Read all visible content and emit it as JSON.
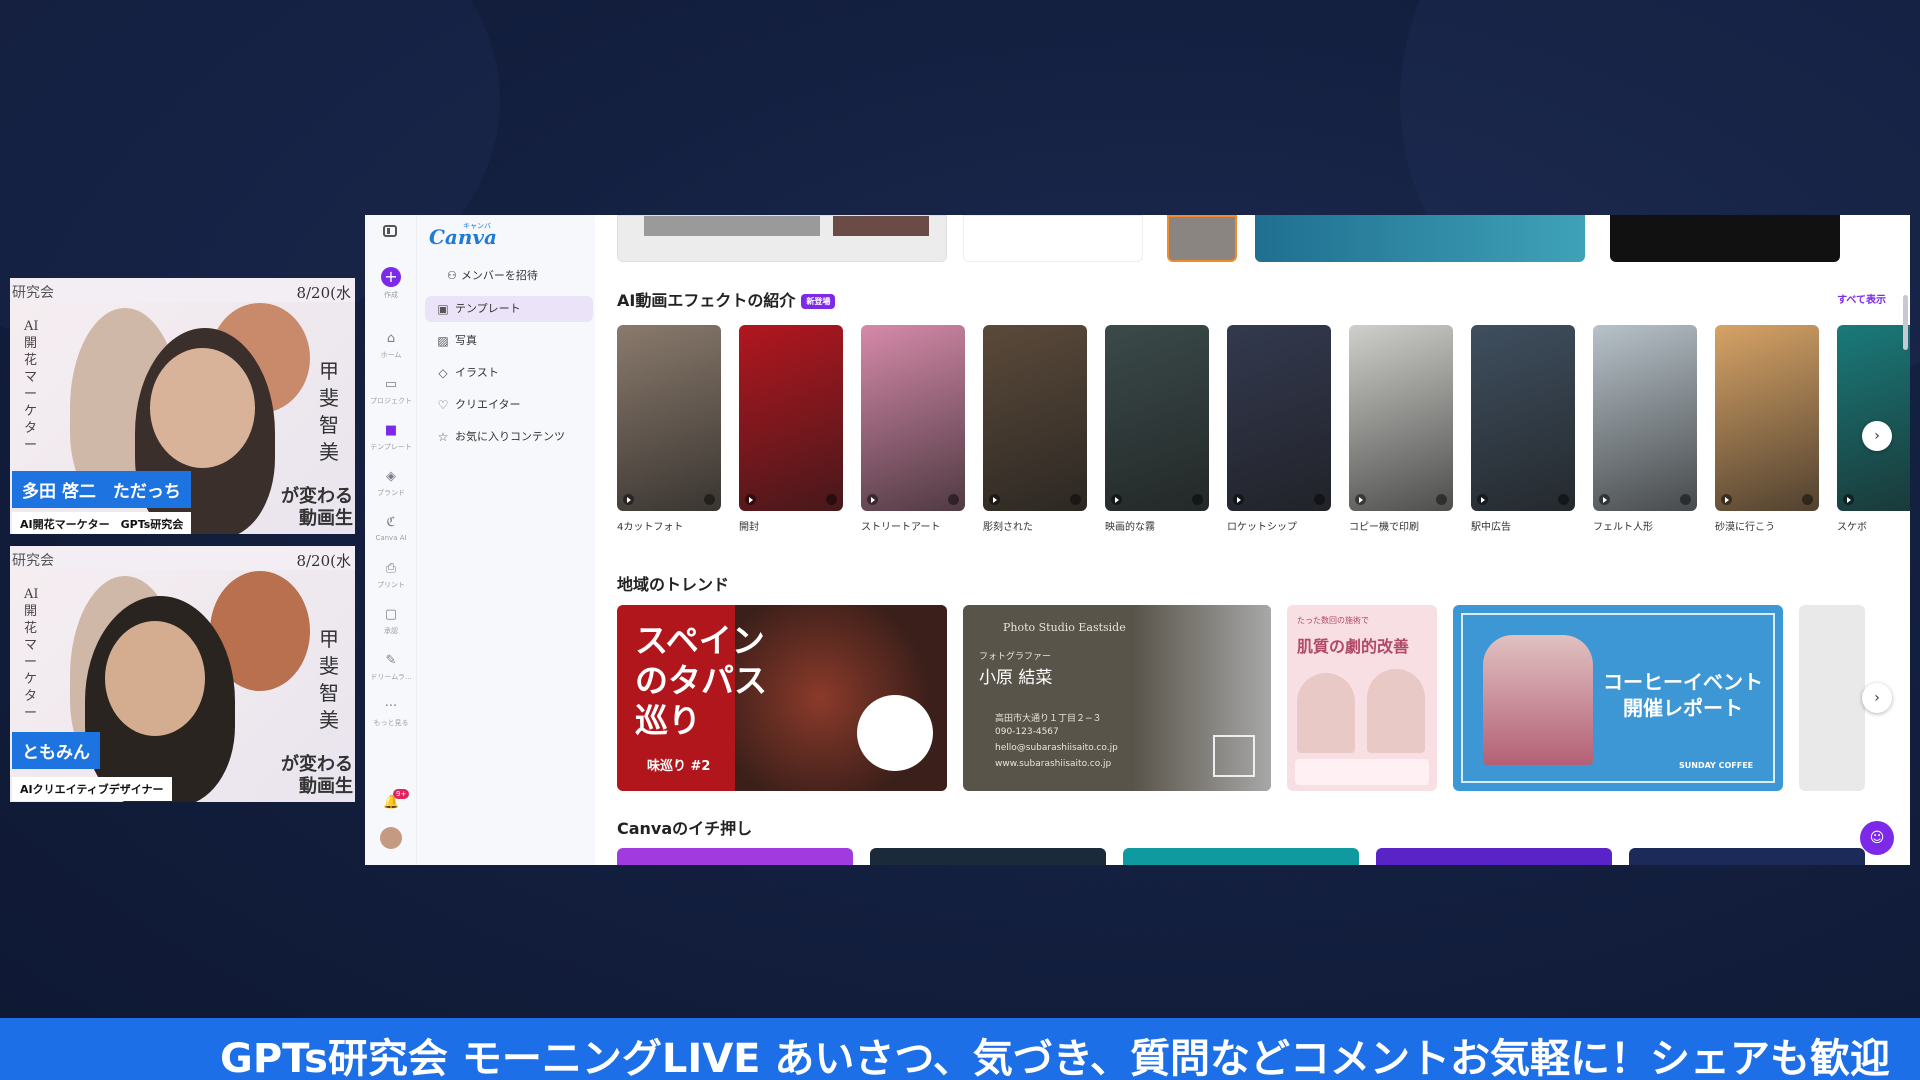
{
  "speakers": [
    {
      "name": "多田 啓二　ただっち",
      "role": "AI開花マーケター　GPTs研究会",
      "header_left": "研究会",
      "header_right": "8/20(水",
      "vertical_left": "AI開花マーケター",
      "vertical_right": "甲斐智美",
      "overlay_text": "が変わる",
      "overlay_text2": "動画生"
    },
    {
      "name": "ともみん",
      "role": "AIクリエイティブデザイナー",
      "header_left": "研究会",
      "header_right": "8/20(水",
      "vertical_left": "AI開花マーケター",
      "vertical_right": "甲斐智美",
      "overlay_text": "が変わる",
      "overlay_text2": "動画生"
    }
  ],
  "canva": {
    "logo": "Canva",
    "logo_kana": "キャンバ",
    "rail": [
      {
        "label": "作成"
      },
      {
        "label": "ホーム"
      },
      {
        "label": "プロジェクト"
      },
      {
        "label": "テンプレート"
      },
      {
        "label": "ブランド"
      },
      {
        "label": "Canva AI"
      },
      {
        "label": "プリント"
      },
      {
        "label": "承認"
      },
      {
        "label": "ドリームラ..."
      },
      {
        "label": "もっと見る"
      }
    ],
    "notification_count": "9+",
    "invite_label": "メンバーを招待",
    "nav": [
      {
        "label": "テンプレート",
        "icon": "template-icon"
      },
      {
        "label": "写真",
        "icon": "photo-icon"
      },
      {
        "label": "イラスト",
        "icon": "illustration-icon"
      },
      {
        "label": "クリエイター",
        "icon": "creator-icon"
      },
      {
        "label": "お気に入りコンテンツ",
        "icon": "star-icon"
      }
    ],
    "section_effects": {
      "title": "AI動画エフェクトの紹介",
      "badge": "新登場",
      "see_all": "すべて表示",
      "items": [
        {
          "label": "4カットフォト",
          "color": "#8a7a6c"
        },
        {
          "label": "開封",
          "color": "#b3161f"
        },
        {
          "label": "ストリートアート",
          "color": "#d58aa9"
        },
        {
          "label": "彫刻された",
          "color": "#5b4a3a"
        },
        {
          "label": "映画的な霧",
          "color": "#3b4a4a"
        },
        {
          "label": "ロケットシップ",
          "color": "#33394f"
        },
        {
          "label": "コピー機で印刷",
          "color": "#cfcfcb"
        },
        {
          "label": "駅中広告",
          "color": "#3f4f5f"
        },
        {
          "label": "フェルト人形",
          "color": "#b7c2c9"
        },
        {
          "label": "砂漠に行こう",
          "color": "#d7a366"
        },
        {
          "label": "スケボ",
          "color": "#1a7a7a"
        }
      ]
    },
    "section_trends": {
      "title": "地域のトレンド",
      "tapas_title": "スペイン\nのタパス\n巡り",
      "tapas_sub": "味巡り #2",
      "studio_name": "Photo Studio Eastside",
      "studio_role": "フォトグラファー",
      "studio_person": "小原 結菜",
      "studio_address": "高田市大通り１丁目２−３",
      "studio_phone": "090-123-4567",
      "studio_email": "hello@subarashiisaito.co.jp",
      "studio_web": "www.subarashiisaito.co.jp",
      "skin_small": "たった数回の施術で",
      "skin_title": "肌質の劇的改善",
      "coffee_title": "コーヒーイベント\n開催レポート",
      "coffee_brand": "SUNDAY COFFEE"
    },
    "section_picks": {
      "title": "Canvaのイチ押し"
    }
  },
  "ticker": {
    "text": "GPTs研究会 モーニングLIVE あいさつ、気づき、質問などコメントお気軽に！シェアも歓迎"
  }
}
